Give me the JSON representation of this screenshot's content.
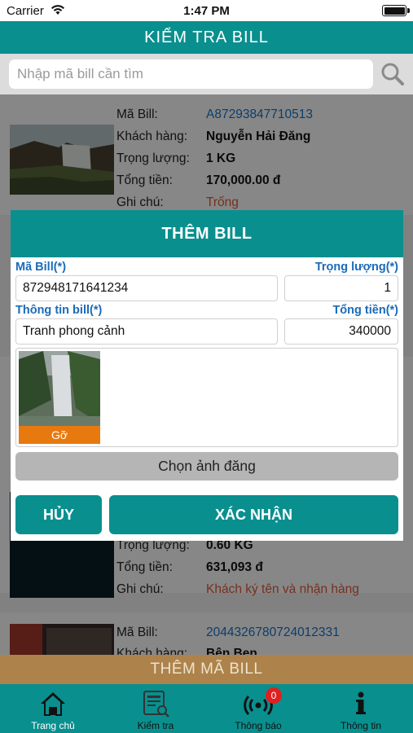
{
  "status_bar": {
    "carrier": "Carrier",
    "time": "1:47 PM"
  },
  "header": {
    "title": "KIỂM TRA BILL"
  },
  "search": {
    "placeholder": "Nhập mã bill cần tìm",
    "icon": "search-icon"
  },
  "bills": [
    {
      "rows": [
        {
          "label": "Mã Bill:",
          "value": "A87293847710513"
        },
        {
          "label": "Khách hàng:",
          "value": "Nguyễn Hải Đăng"
        },
        {
          "label": "Trọng lượng:",
          "value": "1 KG"
        },
        {
          "label": "Tổng tiền:",
          "value": "170,000.00 đ"
        },
        {
          "label": "Ghi chú:",
          "value": "Trống"
        }
      ]
    },
    {
      "rows": [
        {
          "label": "Trọng lượng:",
          "value": "0.60 KG"
        },
        {
          "label": "Tổng tiền:",
          "value": "631,093 đ"
        },
        {
          "label": "Ghi chú:",
          "value": "Khách ký tên và nhận hàng"
        }
      ]
    },
    {
      "rows": [
        {
          "label": "Mã Bill:",
          "value": "2044326780724012331"
        },
        {
          "label": "Khách hàng:",
          "value": "Bện Ben"
        }
      ]
    }
  ],
  "dialog": {
    "title": "THÊM BILL",
    "bill_code_label": "Mã Bill(*)",
    "bill_code_value": "872948171641234",
    "weight_label": "Trọng lượng(*)",
    "weight_value": "1",
    "info_label": "Thông tin bill(*)",
    "info_value": "Tranh phong cảnh",
    "total_label": "Tổng tiền(*)",
    "total_value": "340000",
    "remove_label": "Gỡ",
    "choose_image_label": "Chọn ảnh đăng",
    "cancel_label": "HỦY",
    "confirm_label": "XÁC NHẬN"
  },
  "add_bill_button": "THÊM MÃ BILL",
  "tabs": [
    {
      "label": "Trang chủ",
      "icon": "home-icon"
    },
    {
      "label": "Kiểm tra",
      "icon": "search-document-icon"
    },
    {
      "label": "Thông báo",
      "icon": "broadcast-icon",
      "badge": "0"
    },
    {
      "label": "Thông tin",
      "icon": "info-icon"
    }
  ],
  "colors": {
    "primary": "#0a8f8f",
    "accent_orange": "#e8790f",
    "code_blue": "#1a73c8",
    "note_red": "#e05a3a",
    "label_blue": "#1a6bb8"
  }
}
